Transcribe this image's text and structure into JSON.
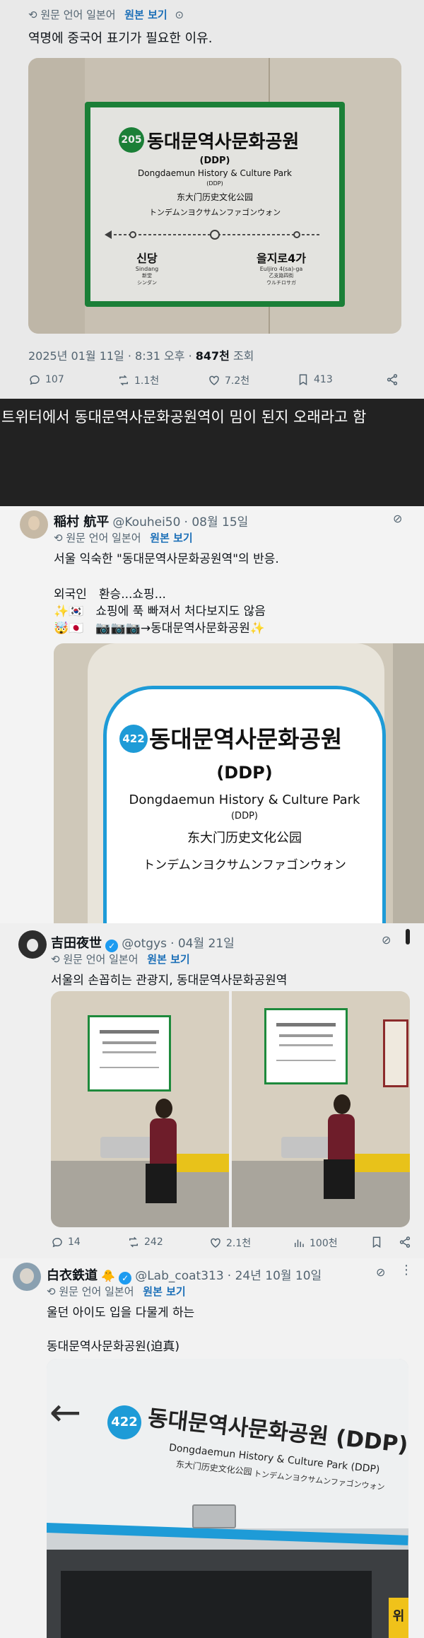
{
  "translate_label": "원문 언어 일본어",
  "view_original": "원본 보기",
  "tweet1": {
    "text": "역명에 중국어 표기가 필요한 이유.",
    "timestamp": "2025년 01월 11일 · 8:31 오후 · ",
    "views_value": "847천",
    "views_suffix": " 조회",
    "replies": "107",
    "retweets": "1.1천",
    "likes": "7.2천",
    "bookmarks": "413",
    "sign": {
      "number": "205",
      "name": "동대문역사문화공원",
      "ddp": "(DDP)",
      "english": "Dongdaemun History & Culture Park",
      "english_sub": "(DDP)",
      "chinese": "东大门历史文化公园",
      "japanese": "トンデムンヨクサムンファゴンウォン",
      "left_station": "신당",
      "left_en": "Sindang",
      "left_cn": "新堂",
      "left_jp": "シンダン",
      "right_station": "을지로4가",
      "right_en": "Euljiro 4(sa)-ga",
      "right_cn": "乙支路四街",
      "right_jp": "ウルチロサガ"
    }
  },
  "banner": {
    "text": "트위터에서 동대문역사문화공원역이 밈이 된지 오래라고 함"
  },
  "tweet2": {
    "name": "稲村 航平",
    "handle": "@Kouhei50",
    "date": "· 08월 15일",
    "line1": "서울 익숙한 \"동대문역사문화공원역\"의 반응.",
    "line2": "외국인　환승...쇼핑...",
    "line3": "✨🇰🇷　쇼핑에 푹 빠져서 처다보지도 않음",
    "line4": "🤯🇯🇵　📷📷📷→동대문역사문화공원✨",
    "sign": {
      "number": "422",
      "name": "동대문역사문화공원",
      "ddp": "(DDP)",
      "english": "Dongdaemun History & Culture Park",
      "english_sub": "(DDP)",
      "chinese": "东大门历史文化公园",
      "japanese": "トンデムンヨクサムンファゴンウォン"
    }
  },
  "tweet3": {
    "name": "吉田夜世",
    "handle": "@otgys",
    "date": "· 04월 21일",
    "text": "서울의 손꼽히는 관광지, 동대문역사문화공원역",
    "replies": "14",
    "retweets": "242",
    "likes": "2.1천",
    "views": "100천"
  },
  "tweet4": {
    "name": "白衣鉄道",
    "emoji": "🐥",
    "handle": "@Lab_coat313",
    "date": "· 24년 10월 10일",
    "line1": "울던 아이도 입을 다물게 하는",
    "line2": "동대문역사문화공원(迫真)",
    "sign": {
      "number": "422",
      "name": "동대문역사문화공원 (DDP)",
      "english": "Dongdaemun History & Culture Park (DDP)",
      "chinese": "东大门历史文化公园",
      "japanese": "トンデムンヨクサムンファゴンウォン",
      "side_char": "위"
    }
  },
  "colors": {
    "sign_green": "#1e8a3c",
    "line_blue": "#1e9bd7",
    "link_blue": "#1d70b8"
  }
}
